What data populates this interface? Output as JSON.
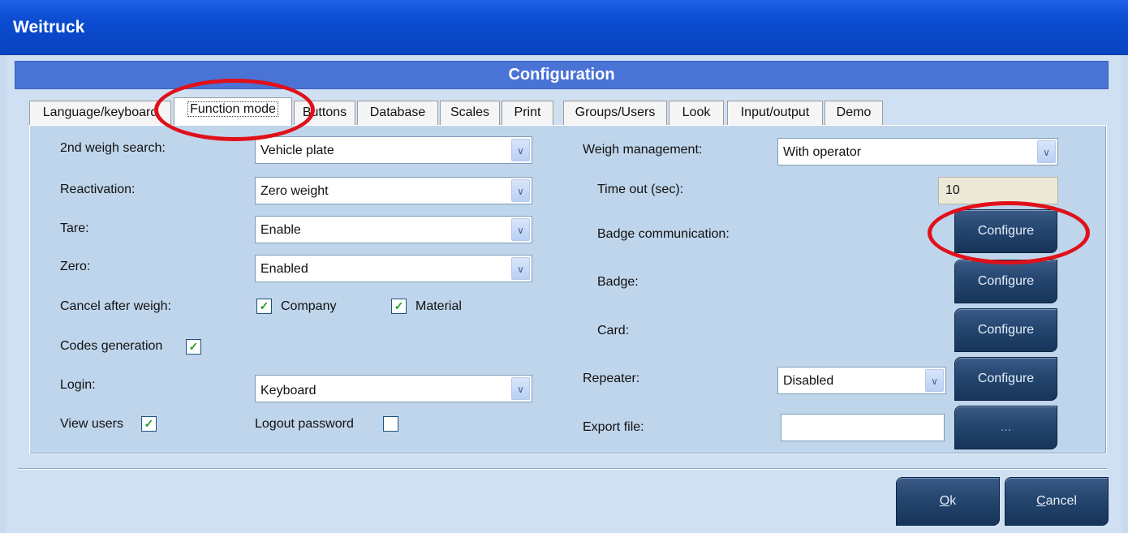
{
  "window": {
    "title": "Weitruck"
  },
  "header": {
    "title": "Configuration"
  },
  "tabs": [
    {
      "label": "Language/keyboard",
      "active": false
    },
    {
      "label": "Function mode",
      "active": true
    },
    {
      "label": "Buttons",
      "active": false
    },
    {
      "label": "Database",
      "active": false
    },
    {
      "label": "Scales",
      "active": false
    },
    {
      "label": "Print",
      "active": false
    },
    {
      "label": "Groups/Users",
      "active": false
    },
    {
      "label": "Look",
      "active": false
    },
    {
      "label": "Input/output",
      "active": false
    },
    {
      "label": "Demo",
      "active": false
    }
  ],
  "left": {
    "second_weigh_search": {
      "label": "2nd weigh search:",
      "value": "Vehicle plate"
    },
    "reactivation": {
      "label": "Reactivation:",
      "value": "Zero weight"
    },
    "tare": {
      "label": "Tare:",
      "value": "Enable"
    },
    "zero": {
      "label": "Zero:",
      "value": "Enabled"
    },
    "cancel_after_weigh": {
      "label": "Cancel after weigh:",
      "company": {
        "label": "Company",
        "checked": true
      },
      "material": {
        "label": "Material",
        "checked": true
      }
    },
    "codes_generation": {
      "label": "Codes generation",
      "checked": true
    },
    "login": {
      "label": "Login:",
      "value": "Keyboard"
    },
    "view_users": {
      "label": "View users",
      "checked": true
    },
    "logout_password": {
      "label": "Logout password",
      "checked": false
    }
  },
  "right": {
    "weigh_management": {
      "label": "Weigh management:",
      "value": "With operator"
    },
    "time_out": {
      "label": "Time out (sec):",
      "value": "10"
    },
    "badge_communication": {
      "label": "Badge communication:",
      "button": "Configure"
    },
    "badge": {
      "label": "Badge:",
      "button": "Configure"
    },
    "card": {
      "label": "Card:",
      "button": "Configure"
    },
    "repeater": {
      "label": "Repeater:",
      "value": "Disabled",
      "button": "Configure"
    },
    "export_file": {
      "label": "Export file:",
      "value": "",
      "button": "..."
    }
  },
  "footer": {
    "ok": {
      "accel": "O",
      "rest": "k"
    },
    "cancel": {
      "accel": "C",
      "rest": "ancel"
    }
  },
  "colors": {
    "title_bar": "#0a4bd0",
    "header_band": "#4a73d6",
    "panel_bg": "#bfd5eb",
    "button_navy": "#24466f",
    "annotation_red": "#e0101a",
    "check_green": "#21a121"
  },
  "icons": {
    "combo_arrow": "chevron-down-icon",
    "checkbox": "checkmark-icon"
  }
}
